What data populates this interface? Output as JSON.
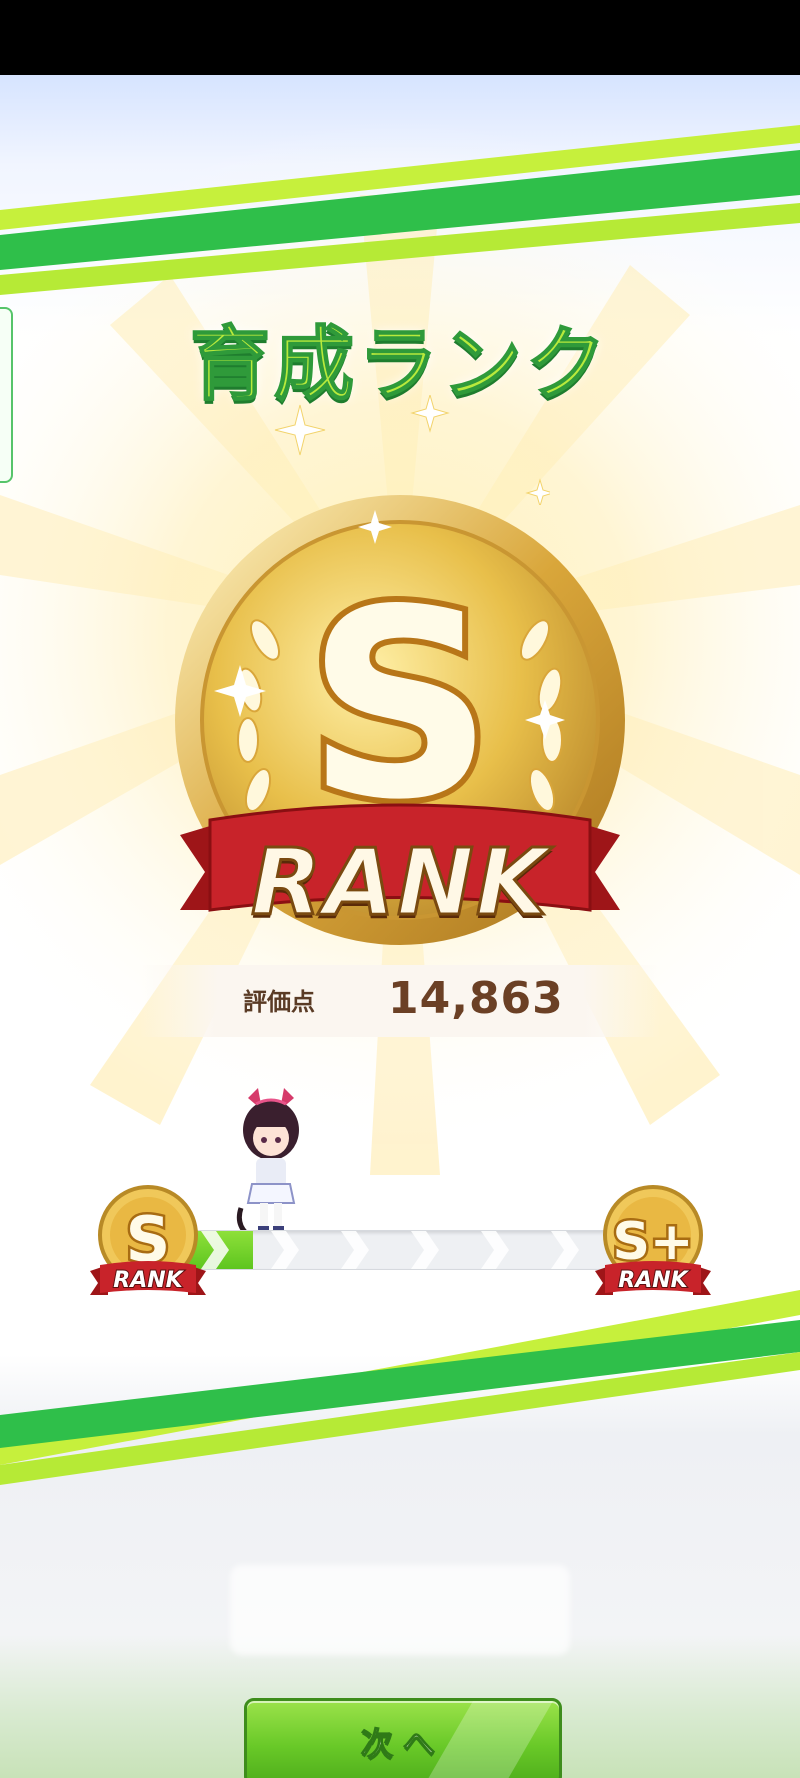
{
  "screen": {
    "title": "育成ランク",
    "rank": {
      "letter": "S",
      "word": "RANK"
    },
    "score": {
      "label": "評価点",
      "value": "14,863"
    },
    "progress": {
      "current_rank_letter": "S",
      "current_rank_word": "RANK",
      "next_rank_letter": "S+",
      "next_rank_word": "RANK",
      "fraction": 0.16
    },
    "next_button": {
      "label": "次へ"
    }
  },
  "colors": {
    "accent_green": "#5ec51f",
    "stripe_green": "#2fbf4a",
    "stripe_lime": "#c6f03c",
    "gold": "#e6b93a",
    "ribbon_red": "#c41f22",
    "score_brown": "#6b4025"
  },
  "icons": [
    "sparkle-icon",
    "laurel-icon",
    "chevron-right-icon"
  ]
}
